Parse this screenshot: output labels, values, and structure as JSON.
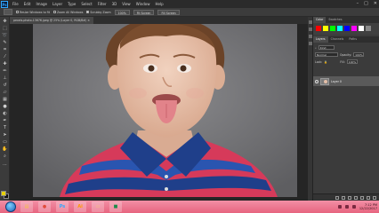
{
  "menubar": {
    "logo": "Ps",
    "items": [
      "File",
      "Edit",
      "Image",
      "Layer",
      "Type",
      "Select",
      "Filter",
      "3D",
      "View",
      "Window",
      "Help"
    ],
    "window_controls": [
      "–",
      "□",
      "✕"
    ]
  },
  "options": {
    "checks": [
      {
        "label": "Resize Windows to fit",
        "checked": false
      },
      {
        "label": "Zoom All Windows",
        "checked": false
      },
      {
        "label": "Scrubby Zoom",
        "checked": true
      }
    ],
    "buttons": [
      "100%",
      "Fit Screen",
      "Fill Screen"
    ]
  },
  "document": {
    "tab_title": "pexels-photo-13676.jpeg @ 25% (Layer 0, RGB/8#) ×"
  },
  "panels": {
    "swatch_tabs": [
      "Color",
      "Swatches"
    ],
    "layer_tabs": [
      "Layers",
      "Channels",
      "Paths"
    ],
    "kind_label": "Kind",
    "blend_mode": "Normal",
    "opacity_label": "Opacity:",
    "opacity_value": "100%",
    "lock_label": "Lock:",
    "fill_label": "Fill:",
    "fill_value": "100%",
    "layer_name": "Layer 0",
    "swatch_colors": [
      "#f00",
      "#ff0",
      "#0f0",
      "#0ff",
      "#00f",
      "#f0f",
      "#fff",
      "#888"
    ]
  },
  "taskbar": {
    "apps": [
      {
        "name": "explorer",
        "glyph": "▤",
        "color": "#f4c542"
      },
      {
        "name": "chrome",
        "glyph": "●",
        "color": "#e14b3b"
      },
      {
        "name": "photoshop",
        "glyph": "Ps",
        "color": "#31a8ff"
      },
      {
        "name": "illustrator",
        "glyph": "Ai",
        "color": "#ff9a00"
      },
      {
        "name": "folder",
        "glyph": "▭",
        "color": "#f2d06b"
      },
      {
        "name": "app",
        "glyph": "■",
        "color": "#1c8c4a"
      }
    ],
    "clock_time": "7:12 PM",
    "clock_date": "12/22/2017"
  }
}
